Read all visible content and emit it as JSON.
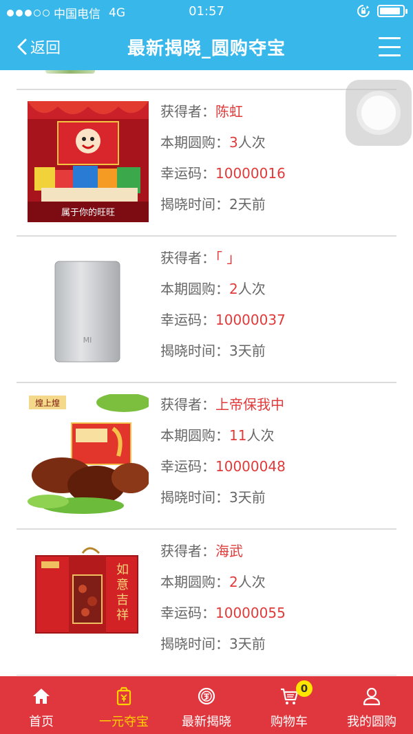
{
  "status_bar": {
    "carrier": "中国电信",
    "network": "4G",
    "time": "01:57",
    "battery_level": 0.9
  },
  "nav": {
    "back_label": "返回",
    "title": "最新揭晓_圆购夺宝"
  },
  "labels": {
    "winner": "获得者：",
    "count": "本期圆购：",
    "code": "幸运码：",
    "time": "揭晓时间："
  },
  "items": [
    {
      "image": "wangwang-gift-box",
      "image_caption": "属于你的旺旺",
      "winner": "陈虹",
      "count": "3",
      "count_unit": "人次",
      "code": "10000016",
      "time": "2天前"
    },
    {
      "image": "mi-power-bank",
      "image_caption": "MI",
      "winner": "「 」",
      "count": "2",
      "count_unit": "人次",
      "code": "10000037",
      "time": "3天前"
    },
    {
      "image": "braised-duck-gift-box",
      "image_caption": "煌上煌",
      "winner": "上帝保我中",
      "count": "11",
      "count_unit": "人次",
      "code": "10000048",
      "time": "3天前"
    },
    {
      "image": "red-gift-box",
      "image_caption": "如意吉祥",
      "winner": "海武",
      "count": "2",
      "count_unit": "人次",
      "code": "10000055",
      "time": "3天前"
    }
  ],
  "tabs": [
    {
      "label": "首页",
      "icon": "home-icon",
      "active": false
    },
    {
      "label": "一元夺宝",
      "icon": "treasure-bag-icon",
      "active": true
    },
    {
      "label": "最新揭晓",
      "icon": "reveal-icon",
      "active": false
    },
    {
      "label": "购物车",
      "icon": "cart-icon",
      "active": false,
      "badge": "0"
    },
    {
      "label": "我的圆购",
      "icon": "user-icon",
      "active": false
    }
  ],
  "colors": {
    "header": "#38b7ea",
    "accent": "#e03a3a",
    "tab_bar": "#e0373e",
    "tab_active": "#ffd200"
  }
}
